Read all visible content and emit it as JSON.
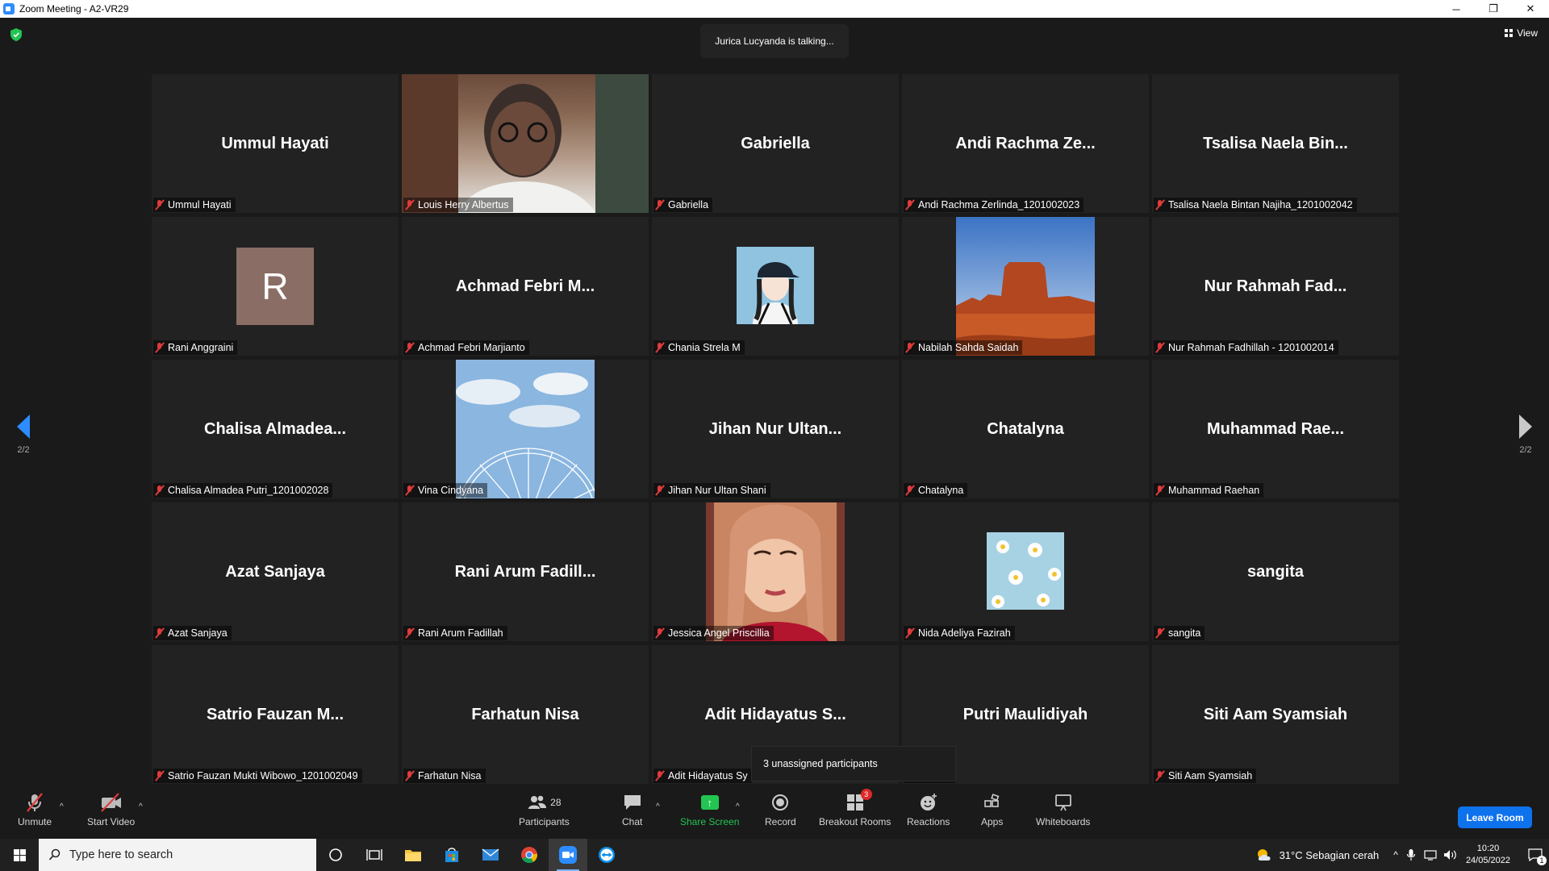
{
  "window": {
    "title": "Zoom Meeting - A2-VR29",
    "controls": [
      "─",
      "❐",
      "✕"
    ]
  },
  "meeting": {
    "talking_indicator": "Jurica Lucyanda is talking...",
    "view_label": "View",
    "page_left": "2/2",
    "page_right": "2/2",
    "tooltip": "3 unassigned participants"
  },
  "participants": [
    {
      "display": "Ummul Hayati",
      "label": "Ummul Hayati",
      "media": "name"
    },
    {
      "display": "",
      "label": "Louis Herry Albertus",
      "media": "video"
    },
    {
      "display": "Gabriella",
      "label": "Gabriella",
      "media": "name"
    },
    {
      "display": "Andi Rachma Ze...",
      "label": "Andi Rachma Zerlinda_1201002023",
      "media": "name"
    },
    {
      "display": "Tsalisa Naela Bin...",
      "label": "Tsalisa Naela Bintan Najiha_1201002042",
      "media": "name"
    },
    {
      "display": "R",
      "label": "Rani Anggraini",
      "media": "initial"
    },
    {
      "display": "Achmad Febri M...",
      "label": "Achmad Febri Marjianto",
      "media": "name"
    },
    {
      "display": "",
      "label": "Chania Strela M",
      "media": "avatar-girl"
    },
    {
      "display": "",
      "label": "Nabilah Sahda Saidah",
      "media": "desert"
    },
    {
      "display": "Nur Rahmah Fad...",
      "label": "Nur Rahmah Fadhillah - 1201002014",
      "media": "name"
    },
    {
      "display": "Chalisa Almadea...",
      "label": "Chalisa Almadea Putri_1201002028",
      "media": "name"
    },
    {
      "display": "",
      "label": "Vina Cindyana",
      "media": "ferris"
    },
    {
      "display": "Jihan Nur Ultan...",
      "label": "Jihan Nur Ultan Shani",
      "media": "name"
    },
    {
      "display": "Chatalyna",
      "label": "Chatalyna",
      "media": "name"
    },
    {
      "display": "Muhammad Rae...",
      "label": "Muhammad Raehan",
      "media": "name"
    },
    {
      "display": "Azat Sanjaya",
      "label": "Azat Sanjaya",
      "media": "name"
    },
    {
      "display": "Rani Arum Fadill...",
      "label": "Rani Arum Fadillah",
      "media": "name"
    },
    {
      "display": "",
      "label": "Jessica Angel Priscillia",
      "media": "selfie"
    },
    {
      "display": "",
      "label": "Nida Adeliya Fazirah",
      "media": "daisy"
    },
    {
      "display": "sangita",
      "label": "sangita",
      "media": "name"
    },
    {
      "display": "Satrio Fauzan M...",
      "label": "Satrio Fauzan Mukti Wibowo_1201002049",
      "media": "name"
    },
    {
      "display": "Farhatun Nisa",
      "label": "Farhatun Nisa",
      "media": "name"
    },
    {
      "display": "Adit Hidayatus S...",
      "label": "Adit Hidayatus Sy",
      "media": "name"
    },
    {
      "display": "Putri Maulidiyah",
      "label": "ulidiyah",
      "media": "name"
    },
    {
      "display": "Siti Aam Syamsiah",
      "label": "Siti Aam Syamsiah",
      "media": "name"
    }
  ],
  "toolbar": {
    "unmute": "Unmute",
    "start_video": "Start Video",
    "participants": "Participants",
    "participants_count": "28",
    "chat": "Chat",
    "share_screen": "Share Screen",
    "record": "Record",
    "breakout_rooms": "Breakout Rooms",
    "breakout_badge": "3",
    "reactions": "Reactions",
    "apps": "Apps",
    "whiteboards": "Whiteboards",
    "leave": "Leave Room"
  },
  "taskbar": {
    "search_placeholder": "Type here to search",
    "weather": "31°C  Sebagian cerah",
    "time": "10:20",
    "date": "24/05/2022",
    "notification_count": "1"
  },
  "colors": {
    "accent": "#2d8cff",
    "leave": "#0e72ed",
    "share_green": "#23c552",
    "muted_red": "#e03b3b"
  }
}
